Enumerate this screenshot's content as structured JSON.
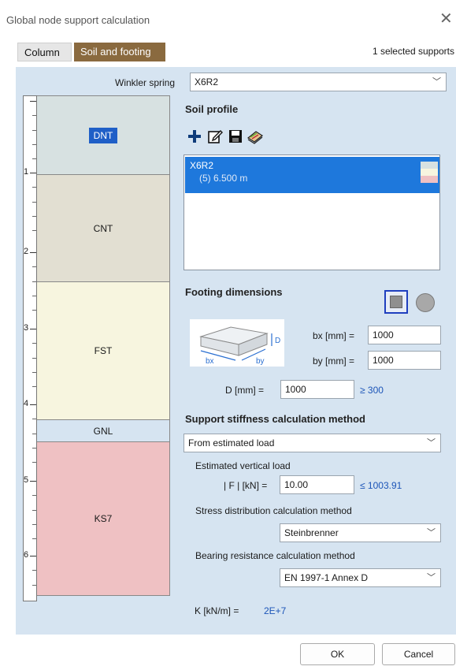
{
  "window": {
    "title": "Global node support calculation"
  },
  "tabs": [
    {
      "label": "Column",
      "active": false
    },
    {
      "label": "Soil and footing",
      "active": true
    }
  ],
  "selected_supports": "1 selected supports",
  "winkler": {
    "label": "Winkler spring",
    "value": "X6R2"
  },
  "soil_profile": {
    "title": "Soil profile",
    "item": {
      "name": "X6R2",
      "detail": "(5) 6.500 m"
    }
  },
  "ruler": {
    "labels": [
      "1",
      "2",
      "3",
      "4",
      "5",
      "6"
    ]
  },
  "layers": [
    {
      "name": "DNT",
      "color": "#d7e1e1"
    },
    {
      "name": "CNT",
      "color": "#e2dfd2"
    },
    {
      "name": "FST",
      "color": "#f7f5df"
    },
    {
      "name": "GNL",
      "color": "#d6e4f1"
    },
    {
      "name": "KS7",
      "color": "#efc1c3"
    }
  ],
  "footing": {
    "title": "Footing dimensions",
    "bx_label": "bx [mm] =",
    "bx": "1000",
    "by_label": "by [mm] =",
    "by": "1000",
    "d_label": "D [mm] =",
    "d": "1000",
    "d_min": "≥ 300",
    "diagram": {
      "bx": "bx",
      "by": "by",
      "d": "D"
    }
  },
  "stiffness": {
    "title": "Support stiffness calculation method",
    "method": "From estimated load",
    "est_load_label": "Estimated vertical load",
    "f_label": "| F | [kN] =",
    "f_value": "10.00",
    "f_max": "≤ 1003.91",
    "stress_label": "Stress distribution calculation method",
    "stress_value": "Steinbrenner",
    "bearing_label": "Bearing resistance calculation method",
    "bearing_value": "EN 1997-1 Annex D",
    "k_label": "K [kN/m] =",
    "k_value": "2E+7"
  },
  "buttons": {
    "ok": "OK",
    "cancel": "Cancel"
  },
  "colors": {
    "accent_tab": "#8a6a3f",
    "selection": "#1e78dc",
    "panel": "#d6e4f1",
    "link_blue": "#1c55b8"
  },
  "icons": [
    "close-icon",
    "add-icon",
    "edit-icon",
    "save-icon",
    "library-icon",
    "square-footing-icon",
    "circle-footing-icon",
    "chevron-down-icon"
  ]
}
